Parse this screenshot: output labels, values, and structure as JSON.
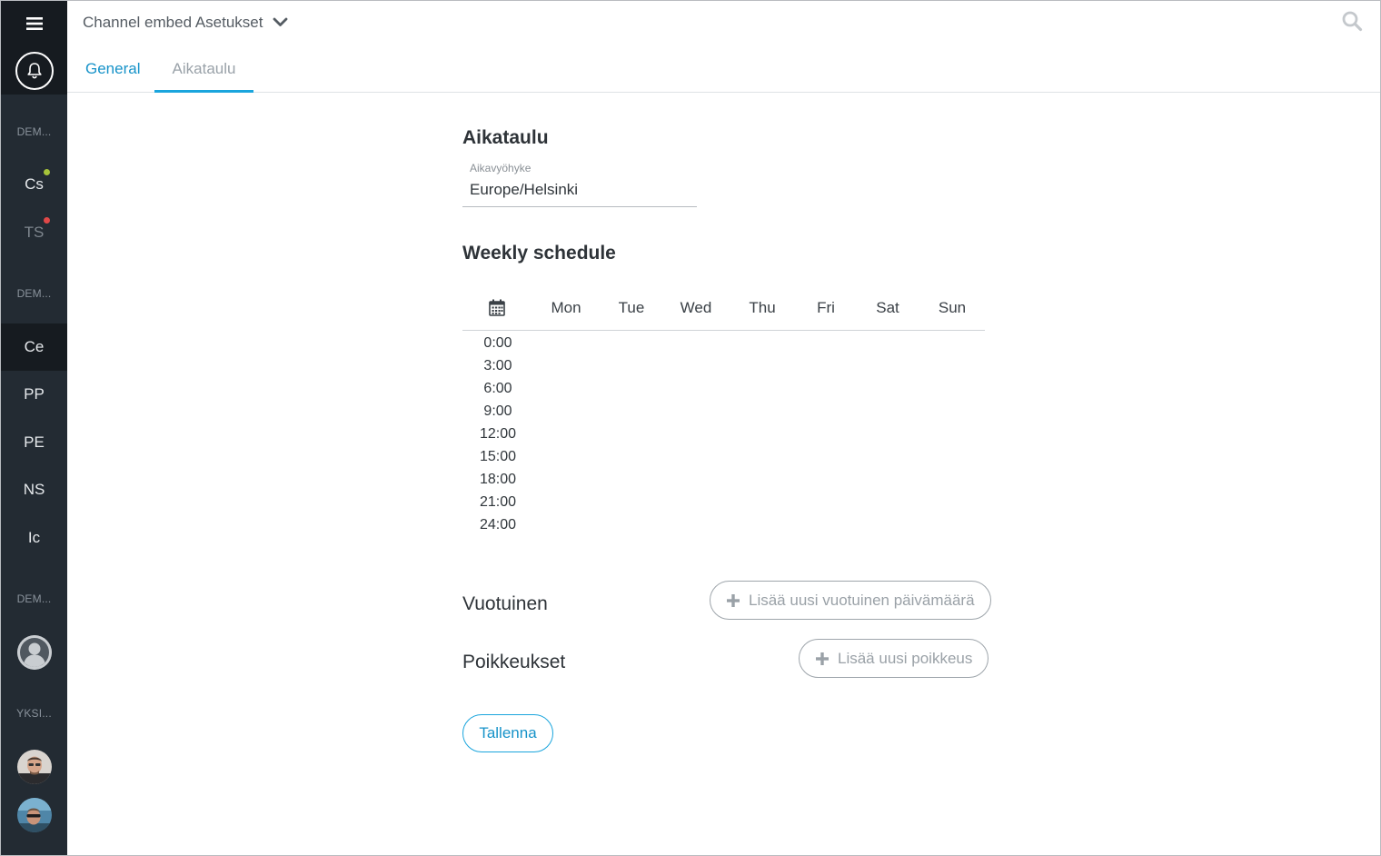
{
  "app": {
    "title": "Channel embed Asetukset"
  },
  "tabs": [
    {
      "label": "General",
      "active": false
    },
    {
      "label": "Aikataulu",
      "active": true
    }
  ],
  "sidebar": {
    "groups": [
      {
        "header": "DEM...",
        "items": [
          {
            "label": "Cs",
            "status_color": "#a6c43a"
          },
          {
            "label": "TS",
            "status_color": "#e04848"
          }
        ]
      },
      {
        "header": "DEM...",
        "items": [
          {
            "label": "Ce",
            "active": true
          },
          {
            "label": "PP"
          },
          {
            "label": "PE"
          },
          {
            "label": "NS"
          },
          {
            "label": "Ic"
          }
        ]
      },
      {
        "header": "DEM...",
        "items": [
          {
            "icon": "user-avatar-icon"
          }
        ]
      },
      {
        "header": "YKSI...",
        "items": [
          {
            "icon": "user-photo-avatar"
          },
          {
            "icon": "user-photo-avatar"
          }
        ]
      }
    ]
  },
  "schedule": {
    "title": "Aikataulu",
    "timezone_label": "Aikavyöhyke",
    "timezone_value": "Europe/Helsinki",
    "weekly_title": "Weekly schedule",
    "days": [
      "Mon",
      "Tue",
      "Wed",
      "Thu",
      "Fri",
      "Sat",
      "Sun"
    ],
    "times": [
      "0:00",
      "3:00",
      "6:00",
      "9:00",
      "12:00",
      "15:00",
      "18:00",
      "21:00",
      "24:00"
    ],
    "annual_label": "Vuotuinen",
    "annual_button": "Lisää uusi vuotuinen päivämäärä",
    "exceptions_label": "Poikkeukset",
    "exceptions_button": "Lisää uusi poikkeus",
    "save_button": "Tallenna"
  },
  "colors": {
    "accent": "#1aa5dd",
    "sidebar_bg": "#232b33",
    "sidebar_active": "#161b20"
  }
}
